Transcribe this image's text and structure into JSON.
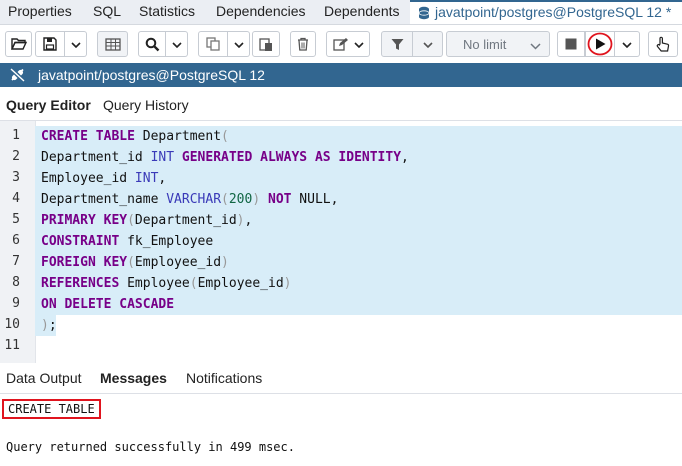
{
  "top_tabs": [
    "Properties",
    "SQL",
    "Statistics",
    "Dependencies",
    "Dependents"
  ],
  "active_tab_label": "javatpoint/postgres@PostgreSQL 12 *",
  "toolbar": {
    "limit_select": "No limit",
    "icons": [
      "open-file-icon",
      "save-icon",
      "chevron-down-icon",
      "grid-icon",
      "find-icon",
      "chevron-down-icon",
      "copy-icon",
      "chevron-down-icon",
      "paste-icon",
      "delete-icon",
      "edit-icon",
      "chevron-down-icon",
      "filter-icon",
      "chevron-down-icon",
      "stop-icon",
      "execute-icon",
      "chevron-down-icon",
      "cursor-icon"
    ]
  },
  "server_bar": {
    "label": "javatpoint/postgres@PostgreSQL 12"
  },
  "query_tabs": [
    "Query Editor",
    "Query History"
  ],
  "editor": {
    "line_numbers": [
      "1",
      "2",
      "3",
      "4",
      "5",
      "6",
      "7",
      "8",
      "9",
      "10",
      "11"
    ]
  },
  "output_tabs": [
    "Data Output",
    "Messages",
    "Notifications"
  ],
  "messages": {
    "result": "CREATE TABLE",
    "status": "Query returned successfully in 499 msec."
  },
  "colors": {
    "accent": "#326690",
    "keyword": "#770088",
    "highlight": "#d8edf8",
    "annotation": "#e0141e"
  }
}
